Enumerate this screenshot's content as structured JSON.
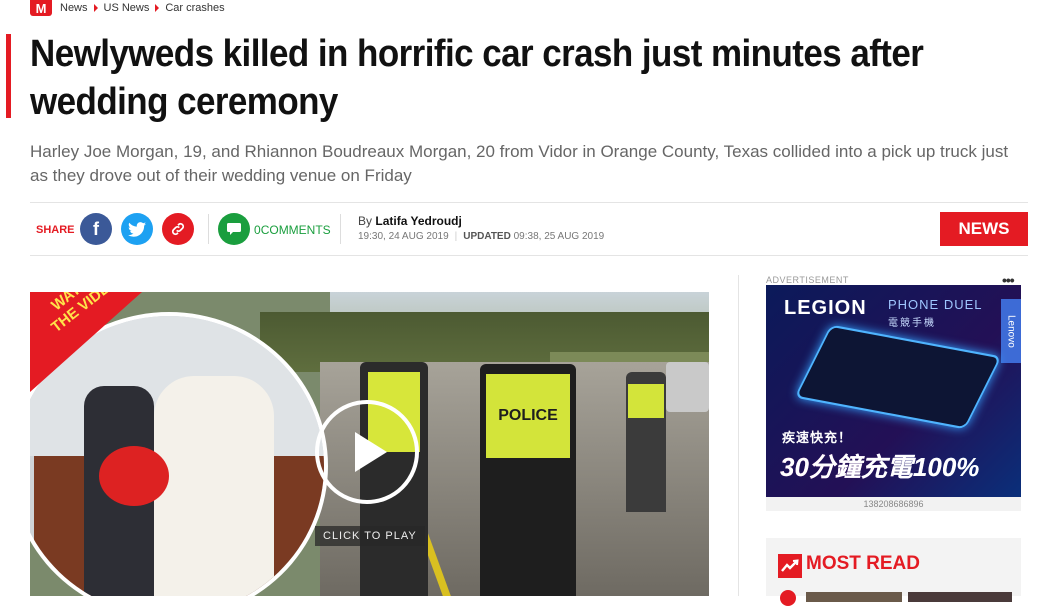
{
  "logo": "M",
  "breadcrumbs": [
    "News",
    "US News",
    "Car crashes"
  ],
  "headline": "Newlyweds killed in horrific car crash just minutes after wedding ceremony",
  "subheadline": "Harley Joe Morgan, 19, and Rhiannon Boudreaux Morgan, 20 from Vidor in Orange County, Texas collided into a pick up truck just as they drove out of their wedding venue on Friday",
  "share": {
    "label": "SHARE",
    "comments_count": "0",
    "comments_label": "COMMENTS"
  },
  "byline": {
    "prefix": "By",
    "author": "Latifa Yedroudj",
    "published": "19:30, 24 AUG 2019",
    "updated_label": "UPDATED",
    "updated": "09:38, 25 AUG 2019"
  },
  "section_tag": "NEWS",
  "video": {
    "badge_line1": "WATCH",
    "badge_line2": "THE VIDEO",
    "click_to_play": "CLICK TO PLAY",
    "police_text": "POLICE"
  },
  "ad": {
    "label": "ADVERTISEMENT",
    "brand": "LEGION",
    "headline": "PHONE DUEL",
    "subtitle_cn": "電競手機",
    "side_brand": "Lenovo",
    "promo_cn": "疾速快充！",
    "promo_big": "30分鐘充電",
    "promo_pct": "100%",
    "id": "138208686896"
  },
  "most_read": {
    "title": "MOST READ"
  },
  "colors": {
    "brand_red": "#e41b23",
    "facebook": "#3b5998",
    "twitter": "#1da1f2",
    "comments_green": "#1a9e3e"
  },
  "icons": [
    "facebook-icon",
    "twitter-icon",
    "link-icon",
    "comment-icon",
    "play-icon",
    "trending-icon",
    "more-dots-icon"
  ]
}
